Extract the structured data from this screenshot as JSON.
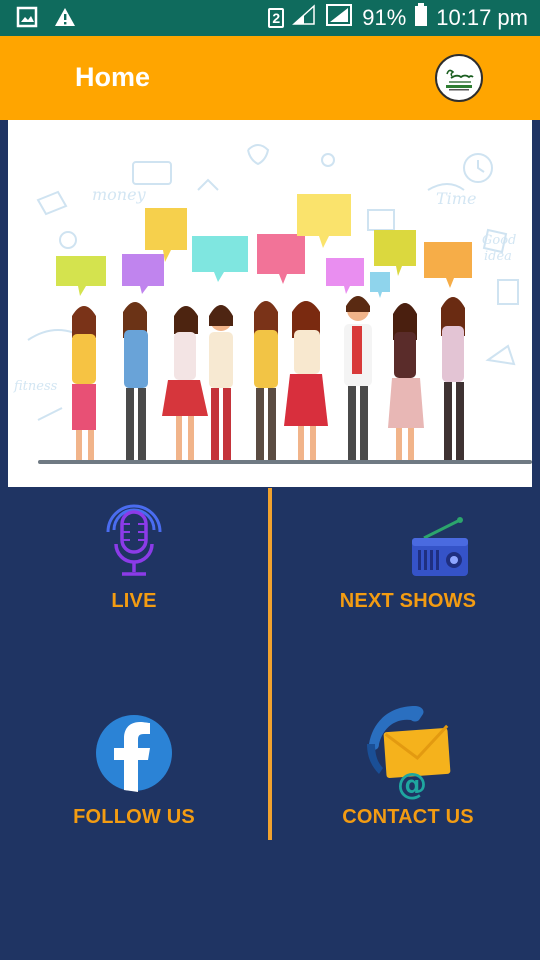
{
  "status_bar": {
    "sim_label": "2",
    "battery": "91%",
    "time": "10:17 pm"
  },
  "app_bar": {
    "title": "Home"
  },
  "tiles": {
    "live": {
      "label": "LIVE"
    },
    "next_shows": {
      "label": "NEXT SHOWS"
    },
    "follow_us": {
      "label": "FOLLOW US"
    },
    "contact_us": {
      "label": "CONTACT US"
    }
  },
  "colors": {
    "status_bar": "#0f6b5d",
    "app_bar": "#ffa500",
    "background": "#1f3463",
    "label": "#f39c12",
    "divider": "#f0a22e"
  },
  "icons": {
    "live": "microphone-icon",
    "next_shows": "radio-icon",
    "follow_us": "facebook-icon",
    "contact_us": "phone-mail-icon"
  }
}
